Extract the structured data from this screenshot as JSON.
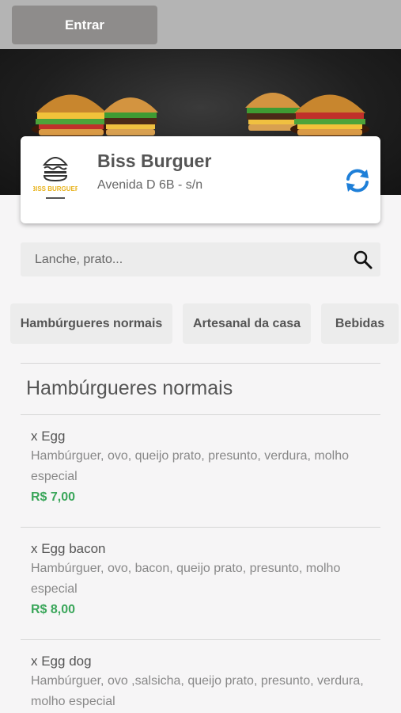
{
  "header": {
    "login_label": "Entrar"
  },
  "store": {
    "name": "Biss Burguer",
    "address": "Avenida D 6B - s/n",
    "logo_text": "BISS BURGUER"
  },
  "search": {
    "placeholder": "Lanche, prato..."
  },
  "categories": [
    {
      "label": "Hambúrgueres normais"
    },
    {
      "label": "Artesanal da casa"
    },
    {
      "label": "Bebidas"
    }
  ],
  "section": {
    "title": "Hambúrgueres normais"
  },
  "items": [
    {
      "name": "x Egg",
      "description": "Hambúrguer, ovo, queijo prato, presunto, verdura, molho especial",
      "price": "R$ 7,00"
    },
    {
      "name": "x Egg bacon",
      "description": "Hambúrguer, ovo, bacon, queijo prato, presunto, molho especial",
      "price": "R$ 8,00"
    },
    {
      "name": "x Egg dog",
      "description": "Hambúrguer, ovo ,salsicha, queijo prato, presunto, verdura, molho especial",
      "price": ""
    }
  ],
  "colors": {
    "accent_price": "#3aa65a",
    "refresh_icon": "#1e7fd8",
    "top_bar": "#b4b4b4",
    "login_button": "#8e8c8b"
  }
}
